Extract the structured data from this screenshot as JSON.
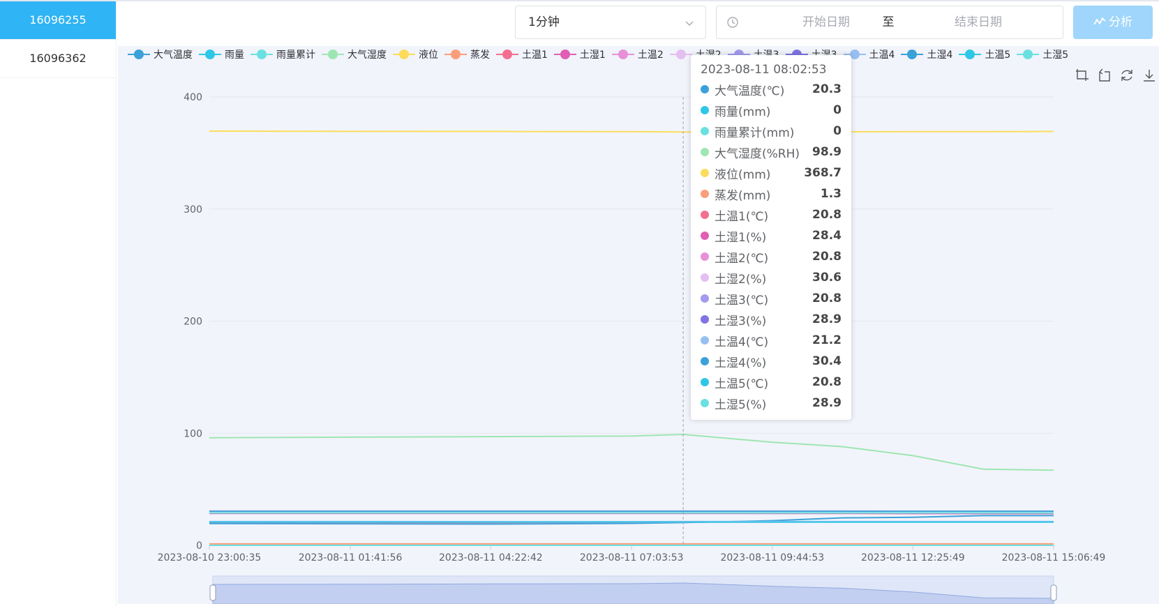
{
  "sidebar": {
    "devices": [
      {
        "label": "16096255",
        "active": true
      },
      {
        "label": "16096362",
        "active": false
      }
    ]
  },
  "toolbar": {
    "interval": "1分钟",
    "start_placeholder": "开始日期",
    "separator": "至",
    "end_placeholder": "结束日期",
    "analyze_label": "分析"
  },
  "tools": [
    "zoom-icon",
    "zoom-reset-icon",
    "refresh-icon",
    "download-icon"
  ],
  "tooltip": {
    "time": "2023-08-11 08:02:53",
    "rows": [
      {
        "name": "大气温度(℃)",
        "value": "20.3",
        "color": "#3ba1d8"
      },
      {
        "name": "雨量(mm)",
        "value": "0",
        "color": "#2ec7e6"
      },
      {
        "name": "雨量累计(mm)",
        "value": "0",
        "color": "#6be0e0"
      },
      {
        "name": "大气湿度(%RH)",
        "value": "98.9",
        "color": "#9ee6b1"
      },
      {
        "name": "液位(mm)",
        "value": "368.7",
        "color": "#fcdc5a"
      },
      {
        "name": "蒸发(mm)",
        "value": "1.3",
        "color": "#fb9e7c"
      },
      {
        "name": "土温1(℃)",
        "value": "20.8",
        "color": "#f36f8f"
      },
      {
        "name": "土湿1(%)",
        "value": "28.4",
        "color": "#e05fb3"
      },
      {
        "name": "土温2(℃)",
        "value": "20.8",
        "color": "#e790d8"
      },
      {
        "name": "土湿2(%)",
        "value": "30.6",
        "color": "#e4bff0"
      },
      {
        "name": "土温3(℃)",
        "value": "20.8",
        "color": "#a49aee"
      },
      {
        "name": "土湿3(%)",
        "value": "28.9",
        "color": "#7f74e2"
      },
      {
        "name": "土温4(℃)",
        "value": "21.2",
        "color": "#97bff3"
      },
      {
        "name": "土湿4(%)",
        "value": "30.4",
        "color": "#3ba1d8"
      },
      {
        "name": "土温5(℃)",
        "value": "20.8",
        "color": "#2ec7e6"
      },
      {
        "name": "土湿5(%)",
        "value": "28.9",
        "color": "#6be0e0"
      }
    ]
  },
  "chart_data": {
    "type": "line",
    "ylim": [
      0,
      400
    ],
    "yticks": [
      "0",
      "100",
      "200",
      "300",
      "400"
    ],
    "xticks": [
      "2023-08-10 23:00:35",
      "2023-08-11 01:41:56",
      "2023-08-11 04:22:42",
      "2023-08-11 07:03:53",
      "2023-08-11 09:44:53",
      "2023-08-11 12:25:49",
      "2023-08-11 15:06:49"
    ],
    "x": [
      "2023-08-10 23:00:35",
      "2023-08-11 01:41:56",
      "2023-08-11 04:22:42",
      "2023-08-11 07:03:53",
      "2023-08-11 08:02:53",
      "2023-08-11 09:44:53",
      "2023-08-11 11:05:00",
      "2023-08-11 12:25:49",
      "2023-08-11 13:46:00",
      "2023-08-11 15:06:49"
    ],
    "cursor_x": "2023-08-11 08:02:53",
    "legend_position": "top",
    "grid": true,
    "series": [
      {
        "name": "大气温度",
        "color": "#3ba1d8",
        "values": [
          19.5,
          19.2,
          19.0,
          19.6,
          20.3,
          22.0,
          24.5,
          25.0,
          26.5,
          26.5
        ]
      },
      {
        "name": "雨量",
        "color": "#2ec7e6",
        "values": [
          0,
          0,
          0,
          0,
          0,
          0,
          0,
          0,
          0,
          0
        ]
      },
      {
        "name": "雨量累计",
        "color": "#6be0e0",
        "values": [
          0,
          0,
          0,
          0,
          0,
          0,
          0,
          0,
          0,
          0
        ]
      },
      {
        "name": "大气湿度",
        "color": "#9ee6b1",
        "values": [
          96,
          96.5,
          97,
          97.5,
          98.9,
          92,
          88,
          80,
          68,
          67
        ]
      },
      {
        "name": "液位",
        "color": "#fcdc5a",
        "values": [
          369.5,
          369.3,
          369.2,
          369.0,
          368.7,
          368.8,
          368.9,
          369.0,
          369.1,
          369.2
        ]
      },
      {
        "name": "蒸发",
        "color": "#fb9e7c",
        "values": [
          1.3,
          1.3,
          1.3,
          1.3,
          1.3,
          1.3,
          1.3,
          1.3,
          1.3,
          1.3
        ]
      },
      {
        "name": "土温1",
        "color": "#f36f8f",
        "values": [
          20.5,
          20.4,
          20.3,
          20.5,
          20.8,
          20.9,
          21.0,
          21.0,
          21.0,
          21.0
        ]
      },
      {
        "name": "土湿1",
        "color": "#e05fb3",
        "values": [
          28.4,
          28.4,
          28.4,
          28.4,
          28.4,
          28.4,
          28.4,
          28.3,
          28.3,
          28.3
        ]
      },
      {
        "name": "土温2",
        "color": "#e790d8",
        "values": [
          20.8,
          20.8,
          20.7,
          20.7,
          20.8,
          20.8,
          20.9,
          20.9,
          20.9,
          20.9
        ]
      },
      {
        "name": "土湿2",
        "color": "#e4bff0",
        "values": [
          30.6,
          30.6,
          30.6,
          30.6,
          30.6,
          30.6,
          30.6,
          30.5,
          30.5,
          30.5
        ]
      },
      {
        "name": "土温3",
        "color": "#a49aee",
        "values": [
          20.8,
          20.8,
          20.8,
          20.8,
          20.8,
          20.8,
          20.8,
          20.8,
          20.8,
          20.8
        ]
      },
      {
        "name": "土湿3",
        "color": "#7f74e2",
        "values": [
          28.9,
          28.9,
          28.9,
          28.9,
          28.9,
          28.9,
          28.9,
          28.9,
          28.9,
          28.9
        ]
      },
      {
        "name": "土温4",
        "color": "#97bff3",
        "values": [
          21.2,
          21.2,
          21.1,
          21.1,
          21.2,
          21.2,
          21.2,
          21.2,
          21.2,
          21.2
        ]
      },
      {
        "name": "土湿4",
        "color": "#3ba1d8",
        "values": [
          30.4,
          30.4,
          30.4,
          30.4,
          30.4,
          30.4,
          30.4,
          30.4,
          30.4,
          30.4
        ]
      },
      {
        "name": "土温5",
        "color": "#2ec7e6",
        "values": [
          20.8,
          20.8,
          20.8,
          20.8,
          20.8,
          20.8,
          20.8,
          20.8,
          20.8,
          20.8
        ]
      },
      {
        "name": "土湿5",
        "color": "#6be0e0",
        "values": [
          28.9,
          28.9,
          28.9,
          28.9,
          28.9,
          28.9,
          28.9,
          28.9,
          28.9,
          28.9
        ]
      }
    ]
  }
}
